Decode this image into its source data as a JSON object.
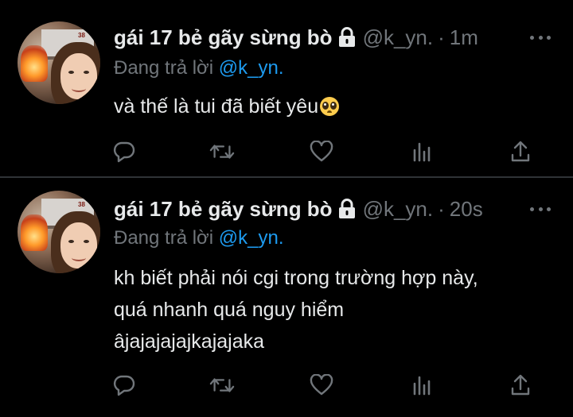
{
  "tweets": [
    {
      "display_name": "gái 17 bẻ gãy sừng bò",
      "handle": "@k_yn.",
      "separator": "·",
      "time": "1m",
      "reply_prefix": "Đang trả lời",
      "reply_to": "@k_yn.",
      "text_lines": [
        "và thế là tui đã biết yêu"
      ],
      "emoji": "pleading-face-emoji",
      "avatar_badge": "38"
    },
    {
      "display_name": "gái 17 bẻ gãy sừng bò",
      "handle": "@k_yn.",
      "separator": "·",
      "time": "20s",
      "reply_prefix": "Đang trả lời",
      "reply_to": "@k_yn.",
      "text_lines": [
        "kh biết phải nói cgi trong trường hợp này,",
        "quá nhanh quá nguy hiểm",
        "âjajajajajkajajaka"
      ],
      "avatar_badge": "38"
    }
  ],
  "icons": {
    "reply": "reply-icon",
    "retweet": "retweet-icon",
    "like": "heart-icon",
    "views": "analytics-icon",
    "share": "share-icon",
    "more": "more-options-icon",
    "protected": "lock-icon"
  },
  "colors": {
    "background": "#000000",
    "text": "#e7e9ea",
    "muted": "#71767b",
    "link": "#1d9bf0",
    "divider": "#2f3336"
  }
}
